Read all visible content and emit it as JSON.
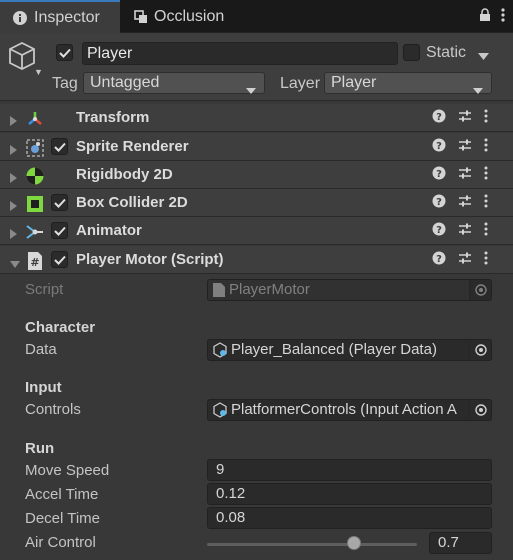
{
  "tabs": [
    {
      "label": "Inspector",
      "icon": "info-icon",
      "active": true
    },
    {
      "label": "Occlusion",
      "icon": "occlusion-icon",
      "active": false
    }
  ],
  "header": {
    "active": true,
    "name": "Player",
    "static_label": "Static",
    "static_checked": false,
    "tag_label": "Tag",
    "tag_value": "Untagged",
    "layer_label": "Layer",
    "layer_value": "Player"
  },
  "components": [
    {
      "title": "Transform",
      "icon": "transform-icon",
      "has_checkbox": false,
      "expanded": false
    },
    {
      "title": "Sprite Renderer",
      "icon": "sprite-renderer-icon",
      "has_checkbox": true,
      "expanded": false
    },
    {
      "title": "Rigidbody 2D",
      "icon": "rigidbody-icon",
      "has_checkbox": false,
      "expanded": false
    },
    {
      "title": "Box Collider 2D",
      "icon": "box-collider-icon",
      "has_checkbox": true,
      "expanded": false
    },
    {
      "title": "Animator",
      "icon": "animator-icon",
      "has_checkbox": true,
      "expanded": false
    },
    {
      "title": "Player Motor (Script)",
      "icon": "script-icon",
      "has_checkbox": true,
      "expanded": true
    }
  ],
  "script_field": {
    "label": "Script",
    "value": "PlayerMotor"
  },
  "sections": {
    "character": "Character",
    "input": "Input",
    "run": "Run"
  },
  "fields": {
    "data_label": "Data",
    "data_value": "Player_Balanced (Player Data)",
    "controls_label": "Controls",
    "controls_value": "PlatformerControls (Input Action A",
    "move_speed_label": "Move Speed",
    "move_speed_value": "9",
    "accel_time_label": "Accel Time",
    "accel_time_value": "0.12",
    "decel_time_label": "Decel Time",
    "decel_time_value": "0.08",
    "air_control_label": "Air Control",
    "air_control_value": "0.7",
    "air_control_fraction": 0.7
  },
  "colors": {
    "tab_accent": "#3a79bb",
    "panel_bg": "#383838",
    "header_bg": "#3e3e3e"
  }
}
